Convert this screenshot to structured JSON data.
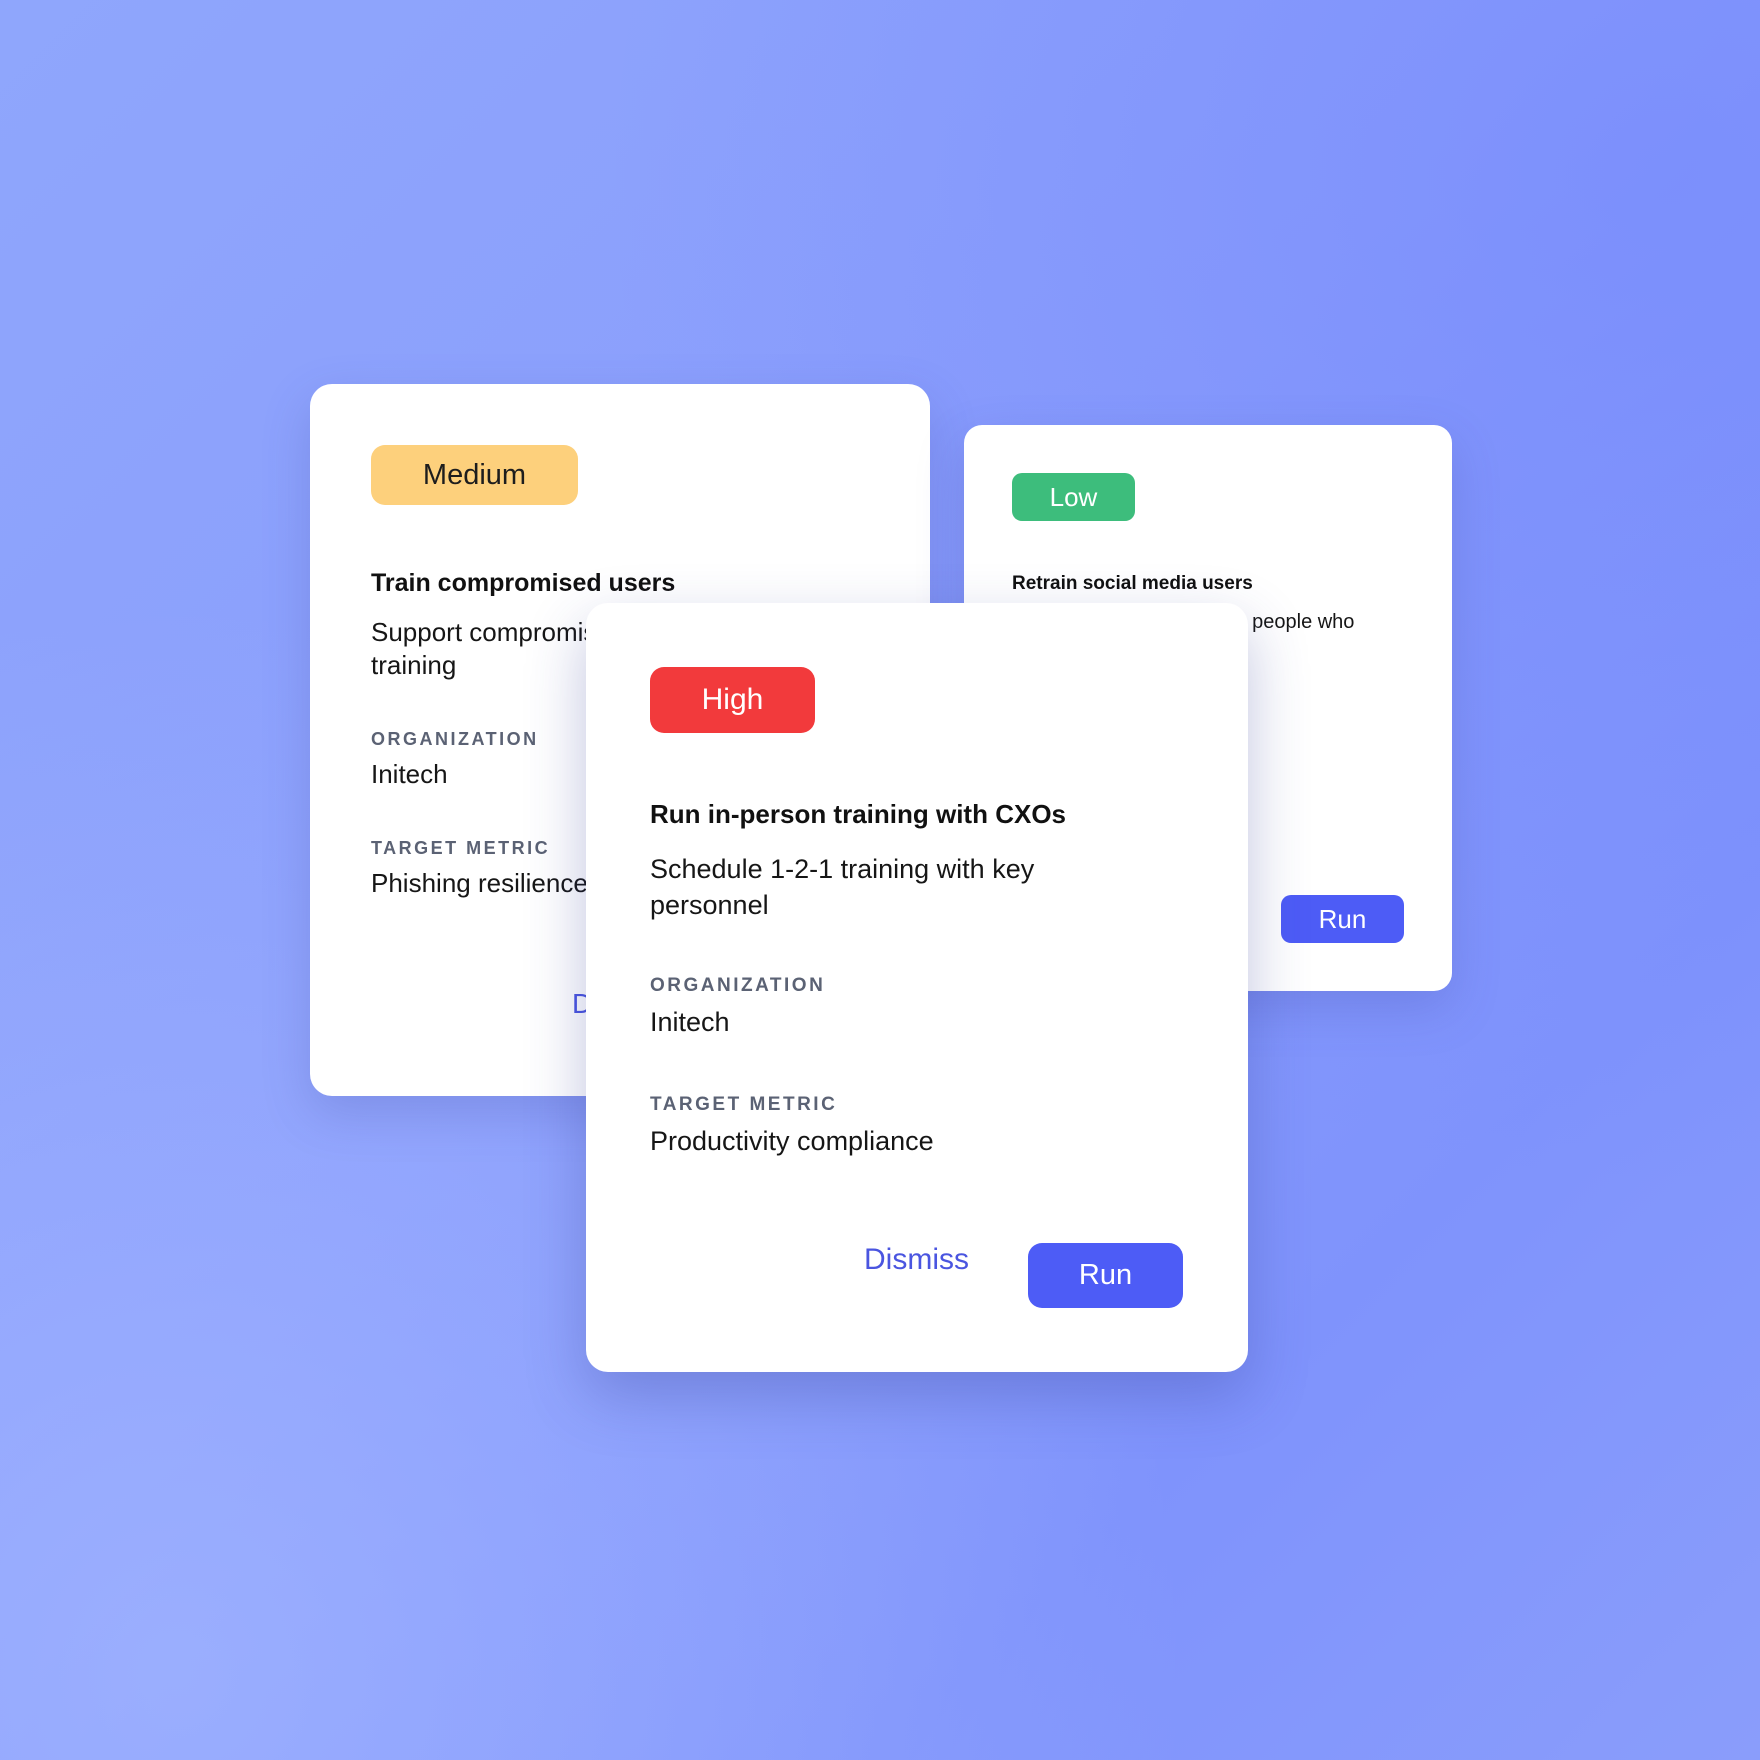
{
  "colors": {
    "background": "#8a9dfd",
    "medium": "#fdd07c",
    "low": "#3dbd7c",
    "high": "#f23a3c",
    "primary_button": "#4d5cf6",
    "link": "#4a55e0",
    "label": "#5b6274"
  },
  "cards": [
    {
      "priority": "Medium",
      "title": "Train compromised users",
      "description": "Support compromised users with targeted training",
      "organization_label": "ORGANIZATION",
      "organization": "Initech",
      "metric_label": "TARGET METRIC",
      "metric": "Phishing resilience",
      "dismiss_label": "Dismiss"
    },
    {
      "priority": "Low",
      "title": "Retrain social media users",
      "description": "Deliver targeted training to people who overshare on social media",
      "run_label": "Run"
    },
    {
      "priority": "High",
      "title": "Run in-person training with CXOs",
      "description": "Schedule 1-2-1 training with key personnel",
      "organization_label": "ORGANIZATION",
      "organization": "Initech",
      "metric_label": "TARGET METRIC",
      "metric": "Productivity compliance",
      "dismiss_label": "Dismiss",
      "run_label": "Run"
    }
  ]
}
